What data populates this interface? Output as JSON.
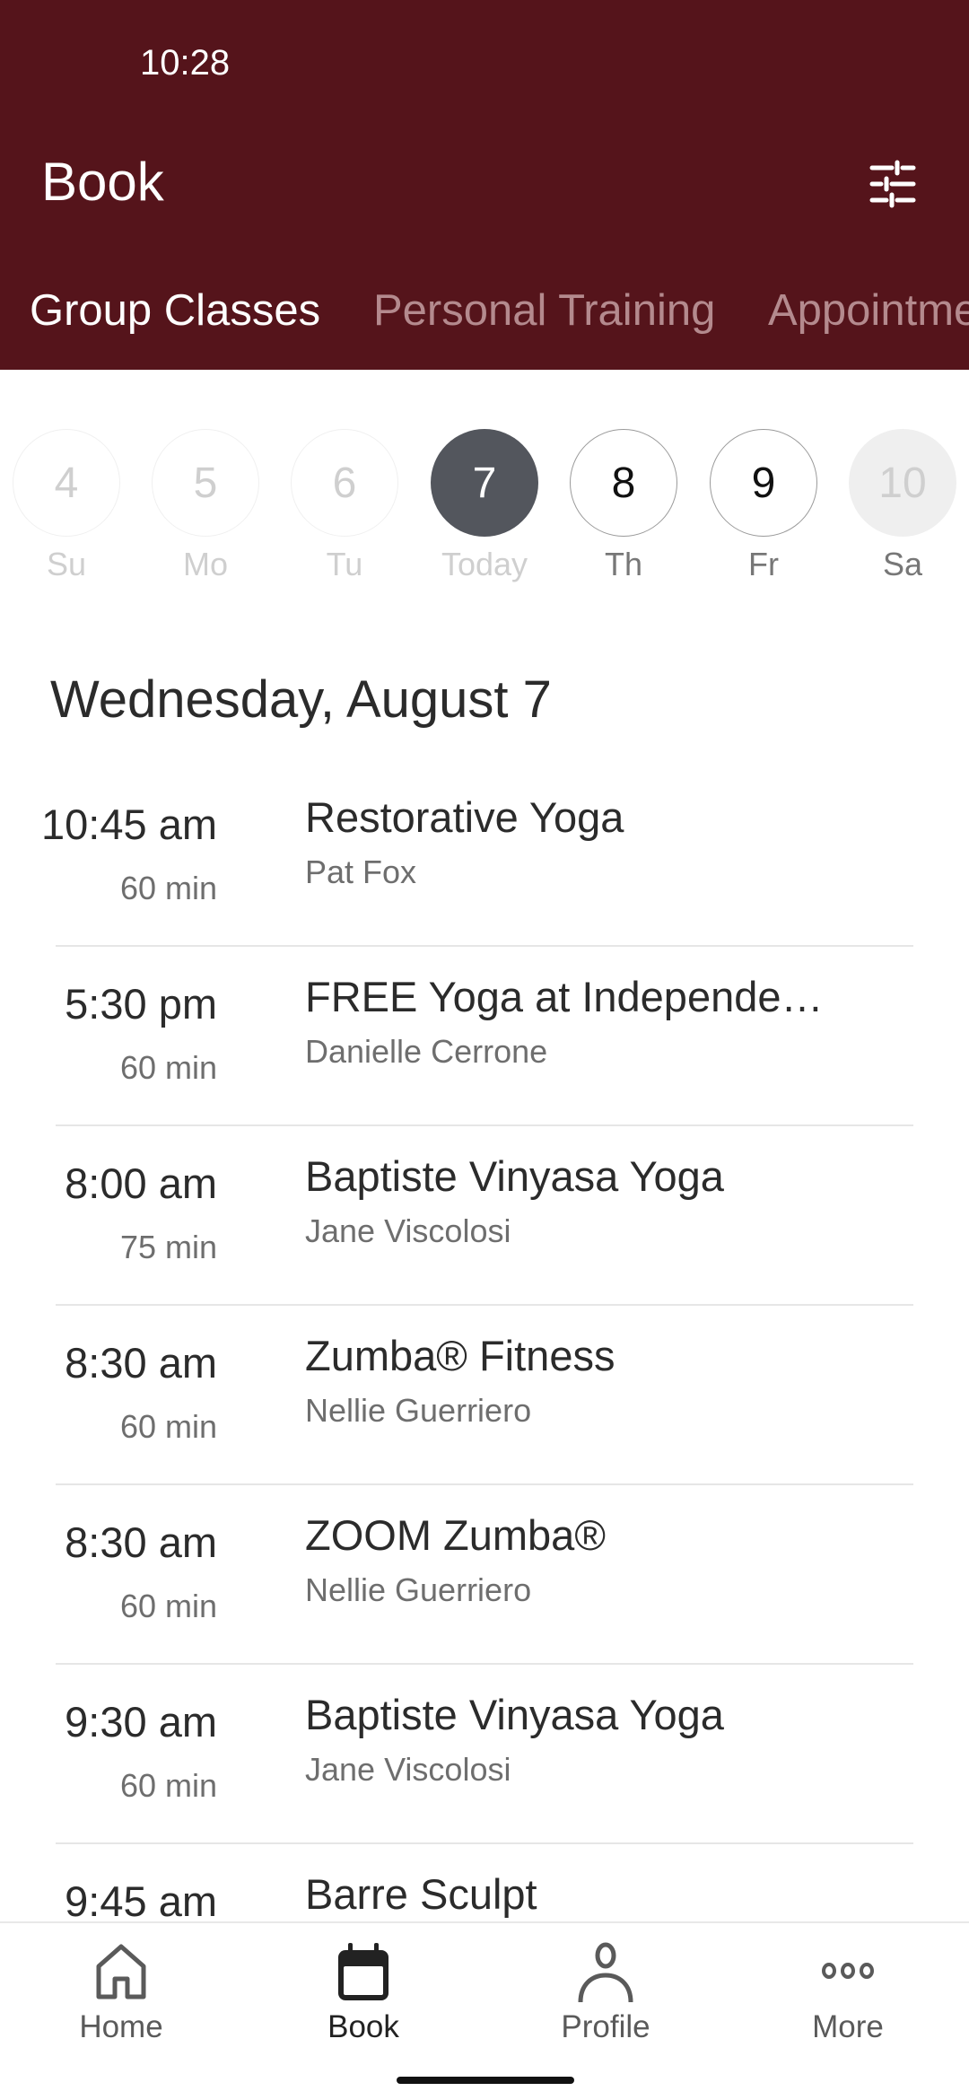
{
  "status_bar": {
    "time": "10:28"
  },
  "header": {
    "title": "Book",
    "filter_icon": "sliders-icon",
    "background_color": "#55141b"
  },
  "tabs": [
    {
      "label": "Group Classes",
      "active": true
    },
    {
      "label": "Personal Training",
      "active": false
    },
    {
      "label": "Appointments",
      "visible_text": "Appointme",
      "active": false
    }
  ],
  "date_strip": [
    {
      "day": "4",
      "label": "Su",
      "state": "past"
    },
    {
      "day": "5",
      "label": "Mo",
      "state": "past"
    },
    {
      "day": "6",
      "label": "Tu",
      "state": "past"
    },
    {
      "day": "7",
      "label": "Today",
      "state": "selected"
    },
    {
      "day": "8",
      "label": "Th",
      "state": "future"
    },
    {
      "day": "9",
      "label": "Fr",
      "state": "future"
    },
    {
      "day": "10",
      "label": "Sa",
      "state": "disabled"
    }
  ],
  "day_heading": "Wednesday, August 7",
  "classes": [
    {
      "time": "10:45 am",
      "duration": "60 min",
      "name": "Restorative Yoga",
      "instructor": "Pat Fox"
    },
    {
      "time": "5:30 pm",
      "duration": "60 min",
      "name": "FREE Yoga at Independe…",
      "instructor": "Danielle Cerrone"
    },
    {
      "time": "8:00 am",
      "duration": "75 min",
      "name": "Baptiste Vinyasa Yoga",
      "instructor": "Jane Viscolosi"
    },
    {
      "time": "8:30 am",
      "duration": "60 min",
      "name": "Zumba® Fitness",
      "instructor": "Nellie Guerriero"
    },
    {
      "time": "8:30 am",
      "duration": "60 min",
      "name": "ZOOM Zumba®",
      "instructor": "Nellie Guerriero"
    },
    {
      "time": "9:30 am",
      "duration": "60 min",
      "name": "Baptiste Vinyasa Yoga",
      "instructor": "Jane Viscolosi"
    },
    {
      "time": "9:45 am",
      "duration": "",
      "name": "Barre Sculpt",
      "instructor": ""
    }
  ],
  "bottom_nav": [
    {
      "label": "Home",
      "icon": "home-icon",
      "active": false
    },
    {
      "label": "Book",
      "icon": "calendar-icon",
      "active": true
    },
    {
      "label": "Profile",
      "icon": "person-icon",
      "active": false
    },
    {
      "label": "More",
      "icon": "more-dots-icon",
      "active": false
    }
  ],
  "colors": {
    "brand": "#55141b",
    "selected_date": "#53565d",
    "text_primary": "#2b2b2b",
    "text_secondary": "#6e6e6e"
  }
}
